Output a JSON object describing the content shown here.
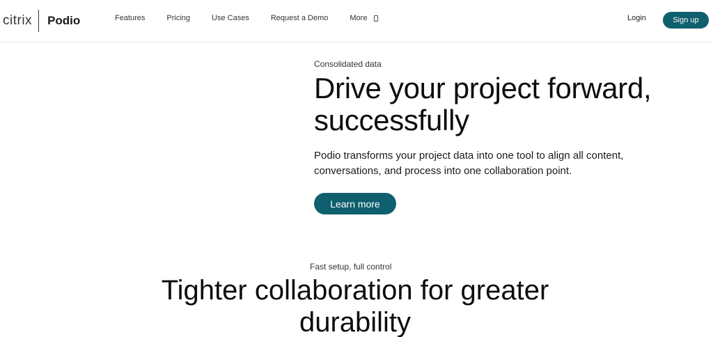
{
  "header": {
    "brand": {
      "citrix": "citrix",
      "product": "Podio"
    },
    "nav": {
      "items": [
        {
          "label": "Features"
        },
        {
          "label": "Pricing"
        },
        {
          "label": "Use Cases"
        },
        {
          "label": "Request a Demo"
        },
        {
          "label": "More"
        }
      ],
      "more_icon": "menu-toggle-icon"
    },
    "login_label": "Login",
    "signup_label": "Sign up"
  },
  "hero": {
    "eyebrow": "Consolidated data",
    "title": "Drive your project forward, successfully",
    "description": "Podio transforms your project data into one tool to align all content, conversations, and process into one collaboration point.",
    "cta_label": "Learn more"
  },
  "section2": {
    "eyebrow": "Fast setup, full control",
    "title": "Tighter collaboration for greater durability"
  },
  "colors": {
    "accent": "#0f5f6e",
    "text": "#1a1a1a",
    "background": "#ffffff"
  }
}
